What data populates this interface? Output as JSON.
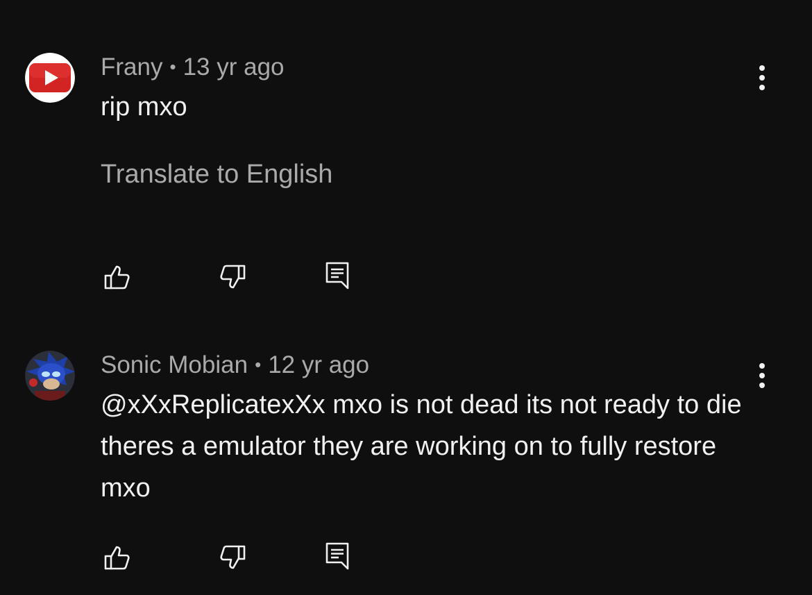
{
  "comments": [
    {
      "author": "Frany",
      "separator": "•",
      "time": "13 yr ago",
      "text": "rip mxo",
      "translate_label": "Translate to English",
      "avatar_icon": "youtube-logo-icon"
    },
    {
      "author": "Sonic Mobian",
      "separator": "•",
      "time": "12 yr ago",
      "text": "@xXxReplicatexXx mxo is not dead its not ready to die theres a emulator they are working on to fully restore mxo",
      "avatar_icon": "sonic-avatar-image"
    }
  ],
  "actions": {
    "like_icon": "thumbs-up-icon",
    "dislike_icon": "thumbs-down-icon",
    "reply_icon": "reply-icon",
    "more_icon": "more-vertical-icon"
  },
  "colors": {
    "background": "#0f0f0f",
    "primary_text": "#f1f1f1",
    "secondary_text": "#aaaaaa",
    "youtube_red": "#e62117"
  }
}
